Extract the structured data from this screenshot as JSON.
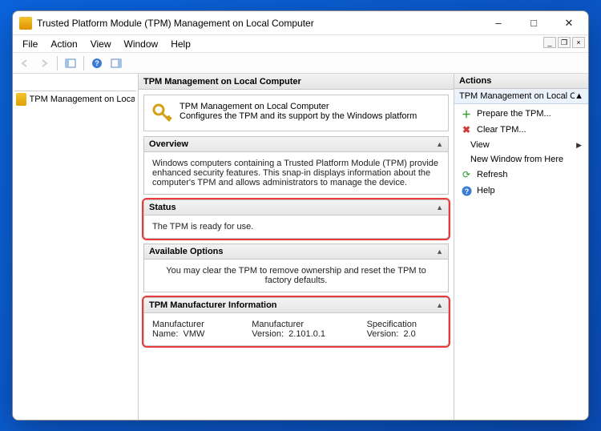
{
  "window": {
    "title": "Trusted Platform Module (TPM) Management on Local Computer"
  },
  "menus": {
    "file": "File",
    "action": "Action",
    "view": "View",
    "window": "Window",
    "help": "Help"
  },
  "tree": {
    "root": "TPM Management on Local Comp"
  },
  "center": {
    "header": "TPM Management on Local Computer",
    "intro_title": "TPM Management on Local Computer",
    "intro_sub": "Configures the TPM and its support by the Windows platform",
    "overview_label": "Overview",
    "overview_text": "Windows computers containing a Trusted Platform Module (TPM) provide enhanced security features. This snap-in displays information about the computer's TPM and allows administrators to manage the device.",
    "status_label": "Status",
    "status_text": "The TPM is ready for use.",
    "available_label": "Available Options",
    "available_text": "You may clear the TPM to remove ownership and reset the TPM to factory defaults.",
    "mfg_label": "TPM Manufacturer Information",
    "mfg_name_label": "Manufacturer Name:",
    "mfg_name_value": "VMW",
    "mfg_ver_label": "Manufacturer Version:",
    "mfg_ver_value": "2.101.0.1",
    "spec_ver_label": "Specification Version:",
    "spec_ver_value": "2.0"
  },
  "actions": {
    "header": "Actions",
    "scope": "TPM Management on Local Computer",
    "prepare": "Prepare the TPM...",
    "clear": "Clear TPM...",
    "view": "View",
    "new_window": "New Window from Here",
    "refresh": "Refresh",
    "help": "Help"
  }
}
